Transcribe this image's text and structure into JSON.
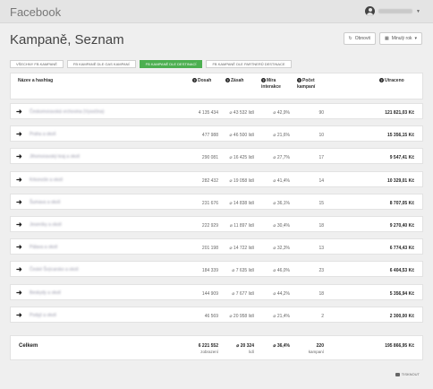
{
  "app": {
    "title": "Facebook"
  },
  "user": {
    "name": ""
  },
  "page": {
    "title": "Kampaně, Seznam"
  },
  "actions": {
    "refresh": "Obnovit",
    "period": "Minulý rok"
  },
  "tabs": [
    {
      "label": "Všechny FB kampaně",
      "active": false
    },
    {
      "label": "FB kampaně dle GAS kampaní",
      "active": false
    },
    {
      "label": "FB kampaně dle destinací",
      "active": true
    },
    {
      "label": "FB kampaně dle partnerů destinace",
      "active": false
    }
  ],
  "columns": {
    "name": "Název a hashtag",
    "reach": "Dosah",
    "impressions": "Zásah",
    "interaction": "Míra interakce",
    "campaigns": "Počet kampaní",
    "spent": "Utraceno"
  },
  "rows": [
    {
      "name": "Českomoravská vrchovina (Vysočina)",
      "reach": "4 135 434",
      "impressions": "⌀ 43 532 lidí",
      "interaction": "⌀ 42,9%",
      "campaigns": "90",
      "spent": "121 821,03 Kč"
    },
    {
      "name": "Praha a okolí",
      "reach": "477 988",
      "impressions": "⌀ 46 500 lidí",
      "interaction": "⌀ 21,6%",
      "campaigns": "10",
      "spent": "15 356,15 Kč"
    },
    {
      "name": "Jihomoravský kraj a okolí",
      "reach": "290 081",
      "impressions": "⌀ 16 425 lidí",
      "interaction": "⌀ 27,7%",
      "campaigns": "17",
      "spent": "9 547,41 Kč"
    },
    {
      "name": "Krkonoše a okolí",
      "reach": "282 432",
      "impressions": "⌀ 19 058 lidí",
      "interaction": "⌀ 41,4%",
      "campaigns": "14",
      "spent": "10 329,01 Kč"
    },
    {
      "name": "Šumava a okolí",
      "reach": "231 676",
      "impressions": "⌀ 14 838 lidí",
      "interaction": "⌀ 36,1%",
      "campaigns": "15",
      "spent": "8 707,05 Kč"
    },
    {
      "name": "Jeseníky a okolí",
      "reach": "222 929",
      "impressions": "⌀ 11 897 lidí",
      "interaction": "⌀ 30,4%",
      "campaigns": "18",
      "spent": "9 270,40 Kč"
    },
    {
      "name": "Pálava a okolí",
      "reach": "201 198",
      "impressions": "⌀ 14 722 lidí",
      "interaction": "⌀ 32,3%",
      "campaigns": "13",
      "spent": "6 774,43 Kč"
    },
    {
      "name": "České Švýcarsko a okolí",
      "reach": "184 339",
      "impressions": "⌀ 7 635 lidí",
      "interaction": "⌀ 46,0%",
      "campaigns": "23",
      "spent": "6 404,53 Kč"
    },
    {
      "name": "Beskydy a okolí",
      "reach": "144 909",
      "impressions": "⌀ 7 677 lidí",
      "interaction": "⌀ 44,2%",
      "campaigns": "18",
      "spent": "5 356,94 Kč"
    },
    {
      "name": "Podyjí a okolí",
      "reach": "46 569",
      "impressions": "⌀ 20 958 lidí",
      "interaction": "⌀ 21,4%",
      "campaigns": "2",
      "spent": "2 300,00 Kč"
    }
  ],
  "total": {
    "label": "Celkem",
    "reach": "6 221 552",
    "reach_unit": "zobrazení",
    "impressions": "⌀ 20 324",
    "impressions_unit": "lidí",
    "interaction": "⌀ 36,4%",
    "campaigns": "220",
    "campaigns_unit": "kampaní",
    "spent": "195 866,95 Kč"
  },
  "footer": {
    "print": "Tisknout"
  },
  "icons": {
    "arrow": "arrow-right-icon",
    "info": "info-icon",
    "refresh": "refresh-icon",
    "calendar": "calendar-icon",
    "print": "print-icon"
  },
  "colors": {
    "accent": "#4caf50"
  }
}
